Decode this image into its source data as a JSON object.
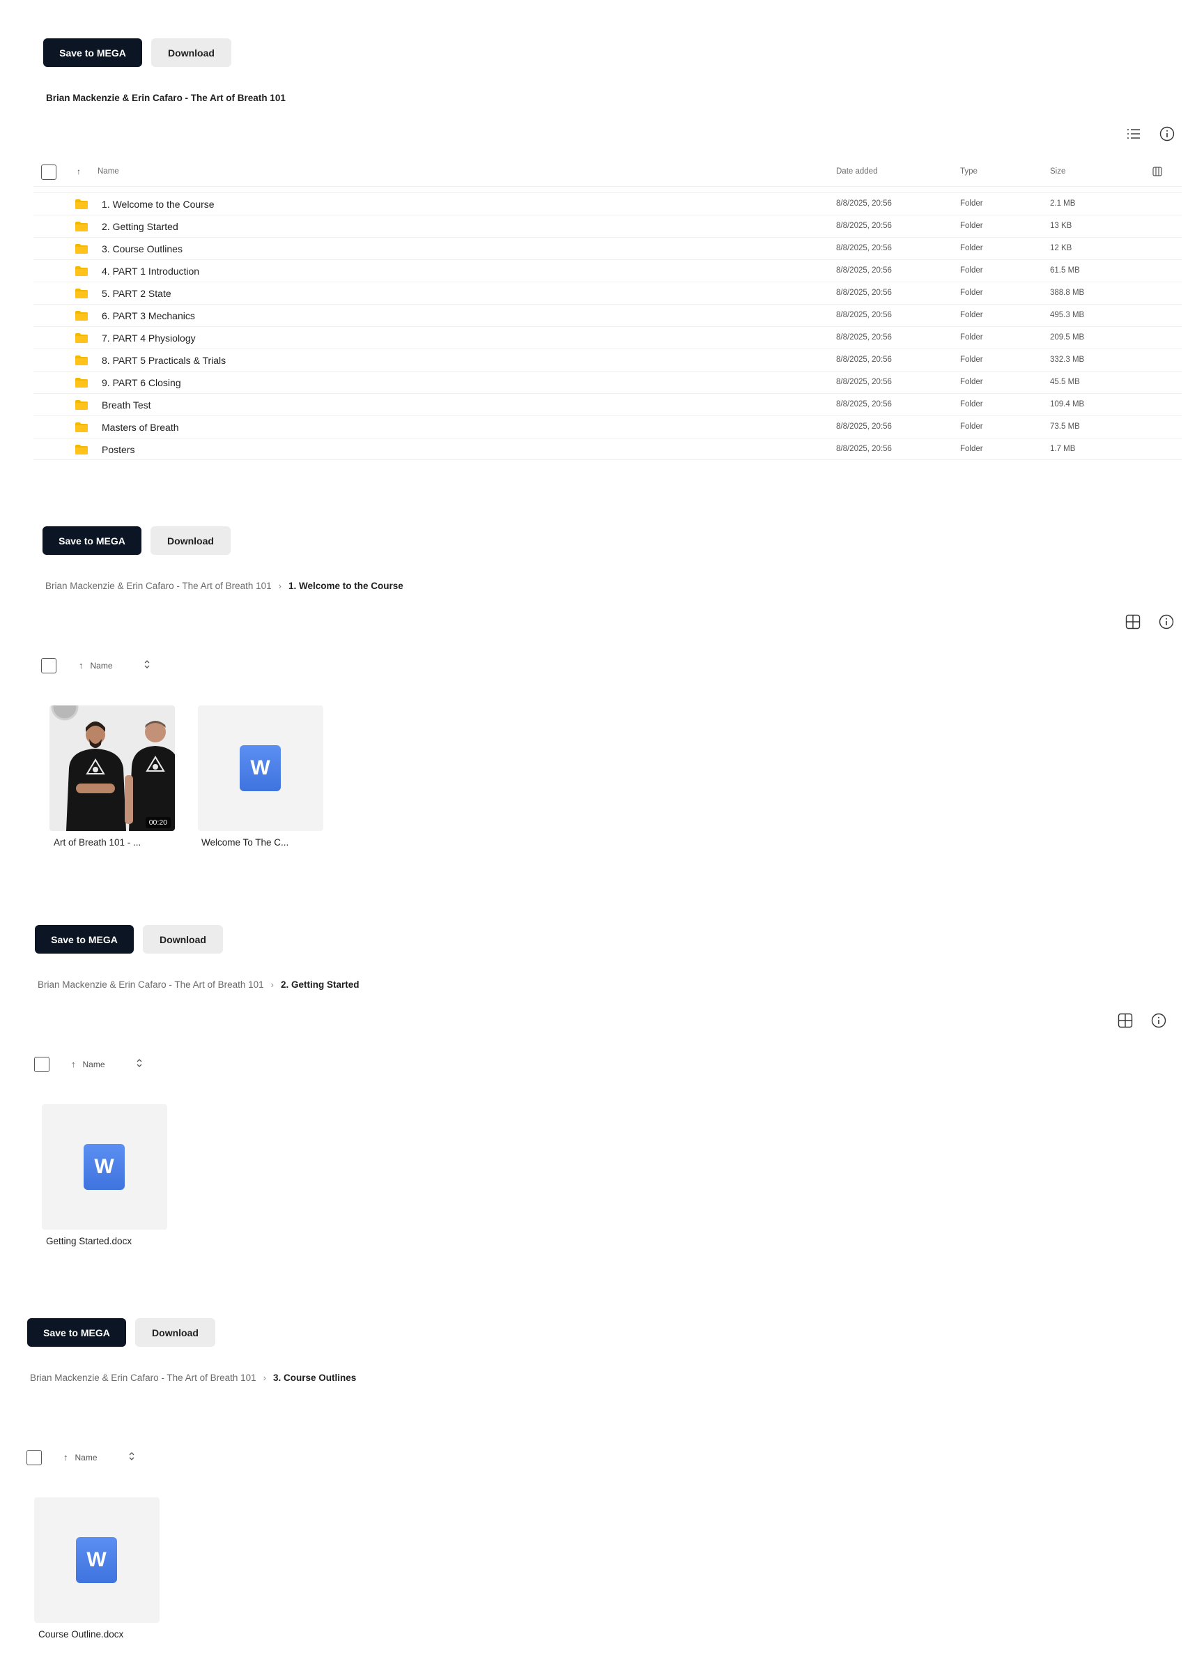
{
  "colors": {
    "primary_button": "#0b1524",
    "secondary_button": "#ececec",
    "folder": "#f5b800",
    "word_blue": "#4a7fe8"
  },
  "panels": {
    "root": {
      "save_label": "Save to MEGA",
      "download_label": "Download",
      "title": "Brian Mackenzie & Erin Cafaro - The Art of Breath 101",
      "columns": {
        "name": "Name",
        "date": "Date added",
        "type": "Type",
        "size": "Size"
      },
      "rows": [
        {
          "name": "1. Welcome to the Course",
          "date": "8/8/2025, 20:56",
          "type": "Folder",
          "size": "2.1 MB"
        },
        {
          "name": "2. Getting Started",
          "date": "8/8/2025, 20:56",
          "type": "Folder",
          "size": "13 KB"
        },
        {
          "name": "3. Course Outlines",
          "date": "8/8/2025, 20:56",
          "type": "Folder",
          "size": "12 KB"
        },
        {
          "name": "4. PART 1 Introduction",
          "date": "8/8/2025, 20:56",
          "type": "Folder",
          "size": "61.5 MB"
        },
        {
          "name": "5. PART 2 State",
          "date": "8/8/2025, 20:56",
          "type": "Folder",
          "size": "388.8 MB"
        },
        {
          "name": "6. PART 3 Mechanics",
          "date": "8/8/2025, 20:56",
          "type": "Folder",
          "size": "495.3 MB"
        },
        {
          "name": "7. PART 4 Physiology",
          "date": "8/8/2025, 20:56",
          "type": "Folder",
          "size": "209.5 MB"
        },
        {
          "name": "8. PART 5 Practicals & Trials",
          "date": "8/8/2025, 20:56",
          "type": "Folder",
          "size": "332.3 MB"
        },
        {
          "name": "9. PART 6 Closing",
          "date": "8/8/2025, 20:56",
          "type": "Folder",
          "size": "45.5 MB"
        },
        {
          "name": "Breath Test",
          "date": "8/8/2025, 20:56",
          "type": "Folder",
          "size": "109.4 MB"
        },
        {
          "name": "Masters of Breath",
          "date": "8/8/2025, 20:56",
          "type": "Folder",
          "size": "73.5 MB"
        },
        {
          "name": "Posters",
          "date": "8/8/2025, 20:56",
          "type": "Folder",
          "size": "1.7 MB"
        }
      ]
    },
    "welcome": {
      "save_label": "Save to MEGA",
      "download_label": "Download",
      "crumb_root": "Brian Mackenzie & Erin Cafaro - The Art of Breath 101",
      "crumb_current": "1. Welcome to the Course",
      "sort_label": "Name",
      "files": [
        {
          "label": "Art of Breath 101 - ...",
          "kind": "video",
          "duration": "00:20"
        },
        {
          "label": "Welcome To The C...",
          "kind": "word",
          "icon_letter": "W"
        }
      ]
    },
    "getting": {
      "save_label": "Save to MEGA",
      "download_label": "Download",
      "crumb_root": "Brian Mackenzie & Erin Cafaro - The Art of Breath 101",
      "crumb_current": "2. Getting Started",
      "sort_label": "Name",
      "files": [
        {
          "label": "Getting Started.docx",
          "kind": "word",
          "icon_letter": "W"
        }
      ]
    },
    "outlines": {
      "save_label": "Save to MEGA",
      "download_label": "Download",
      "crumb_root": "Brian Mackenzie & Erin Cafaro - The Art of Breath 101",
      "crumb_current": "3. Course Outlines",
      "sort_label": "Name",
      "files": [
        {
          "label": "Course Outline.docx",
          "kind": "word",
          "icon_letter": "W"
        }
      ]
    }
  }
}
